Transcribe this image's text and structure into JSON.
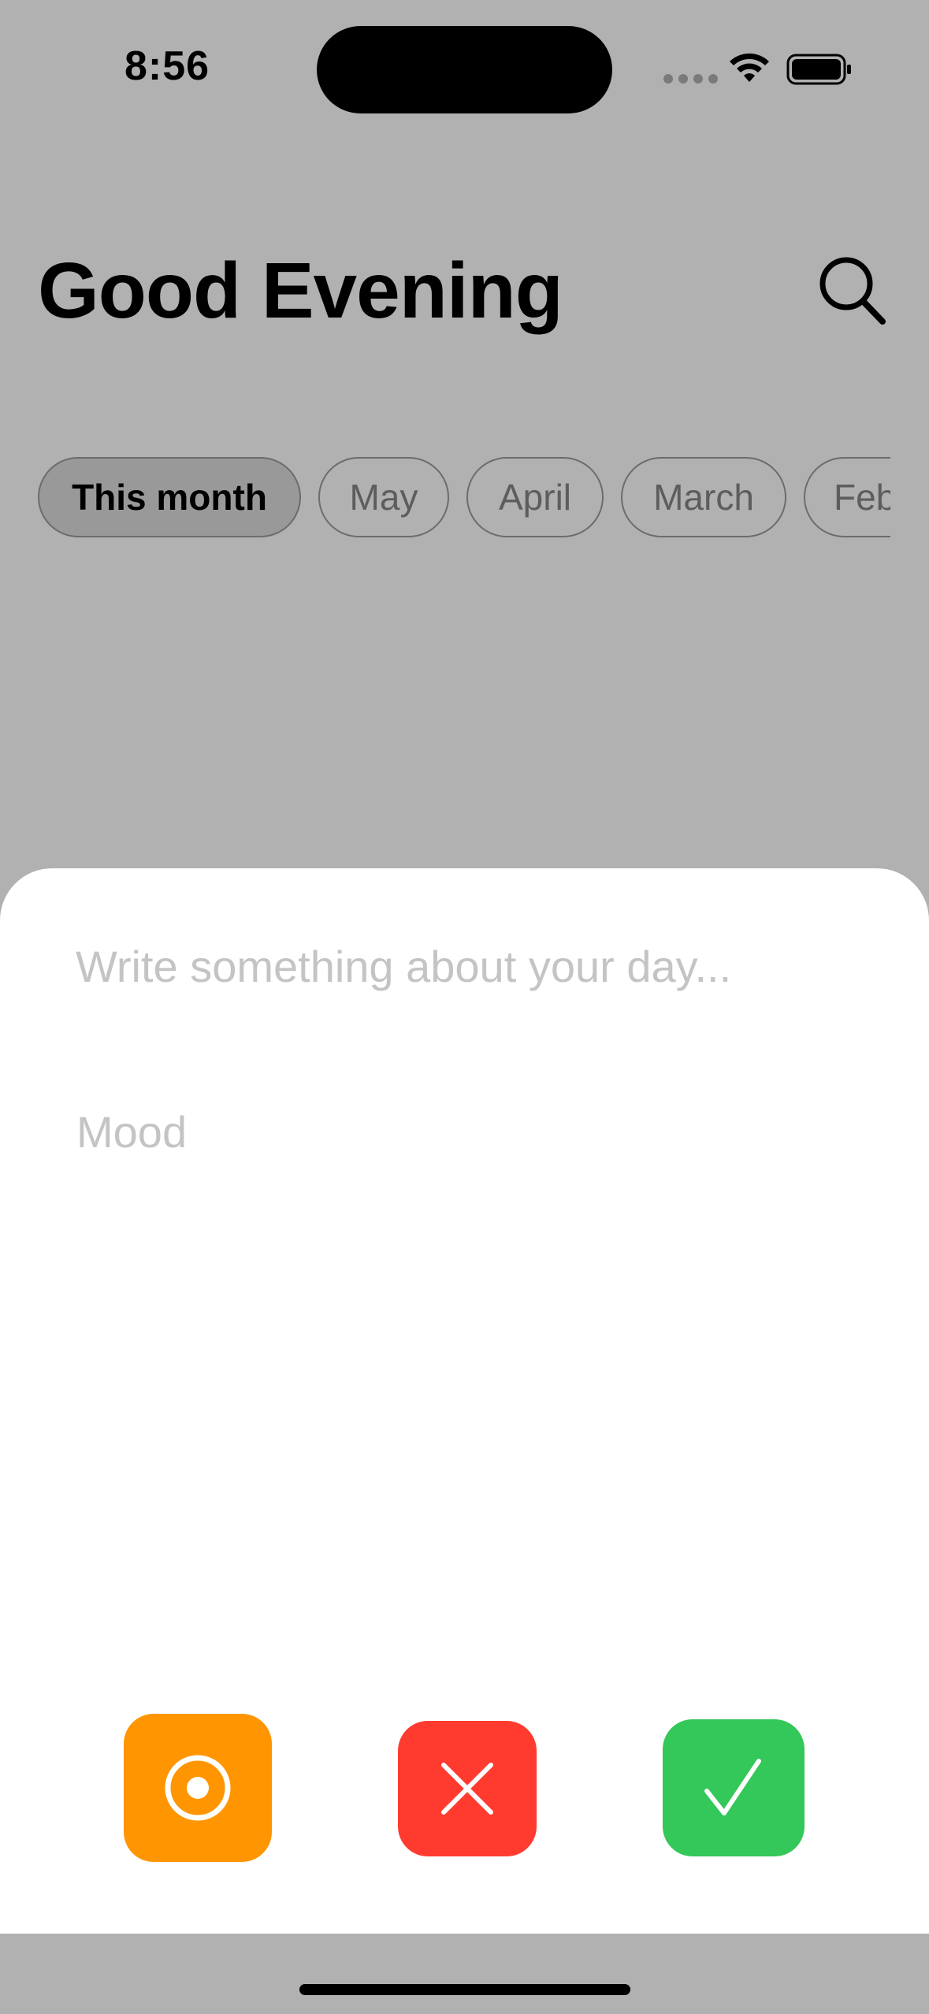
{
  "status_bar": {
    "time": "8:56",
    "icons": [
      "cellular-signal-icon",
      "wifi-icon",
      "battery-icon"
    ]
  },
  "header": {
    "greeting": "Good Evening",
    "search_icon": "search-icon"
  },
  "filters": {
    "chips": [
      {
        "label": "This month",
        "selected": true
      },
      {
        "label": "May",
        "selected": false
      },
      {
        "label": "April",
        "selected": false
      },
      {
        "label": "March",
        "selected": false
      },
      {
        "label": "Feb",
        "selected": false
      }
    ]
  },
  "entry_sheet": {
    "journal_placeholder": "Write something about your day...",
    "mood_label": "Mood",
    "actions": [
      {
        "name": "record",
        "icon": "record-icon",
        "color": "#ff9500"
      },
      {
        "name": "discard",
        "icon": "close-icon",
        "color": "#ff3b30"
      },
      {
        "name": "save",
        "icon": "checkmark-icon",
        "color": "#34c759"
      }
    ]
  },
  "colors": {
    "overlay_background": "#b1b1b1",
    "sheet_background": "#ffffff",
    "placeholder_text": "#c4c4c6"
  }
}
